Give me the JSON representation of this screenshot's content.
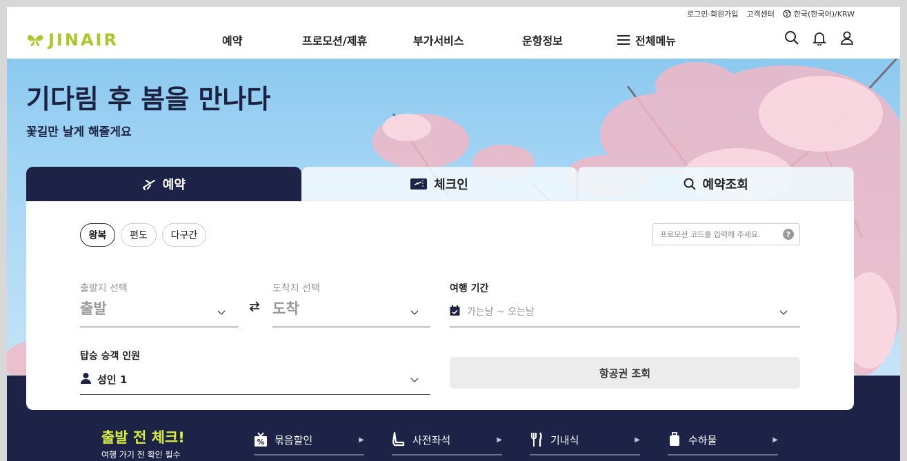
{
  "util": {
    "login": "로그인·회원가입",
    "customer_center": "고객센터",
    "locale": "한국(한국어)/KRW"
  },
  "header": {
    "logo": "JINAIR",
    "nav": [
      "예약",
      "프로모션/제휴",
      "부가서비스",
      "운항정보",
      "전체메뉴"
    ]
  },
  "hero": {
    "title": "기다림 후 봄을 만나다",
    "subtitle": "꽃길만 날게 해줄게요"
  },
  "tabs": [
    {
      "label": "예약"
    },
    {
      "label": "체크인"
    },
    {
      "label": "예약조회"
    }
  ],
  "booking": {
    "trip_types": [
      "왕복",
      "편도",
      "다구간"
    ],
    "selected_trip_type": "왕복",
    "promo_placeholder": "프로모션 코드를 입력해 주세요.",
    "promo_help": "?",
    "origin_label": "출발지 선택",
    "origin_value": "출발",
    "destination_label": "도착지 선택",
    "destination_value": "도착",
    "period_label": "여행 기간",
    "period_placeholder": "가는날 ~ 오는날",
    "passengers_label": "탑승 승객 인원",
    "passengers_value": "성인 1",
    "search_button": "항공권 조회"
  },
  "band": {
    "title": "출발 전 체크!",
    "subtitle": "여행 가기 전 확인 필수",
    "services": [
      "묶음할인",
      "사전좌석",
      "기내식",
      "수하물"
    ]
  },
  "colors": {
    "navy": "#1c2346",
    "brand_lime": "#a8c92a",
    "accent_yellow": "#d9ef3a"
  }
}
